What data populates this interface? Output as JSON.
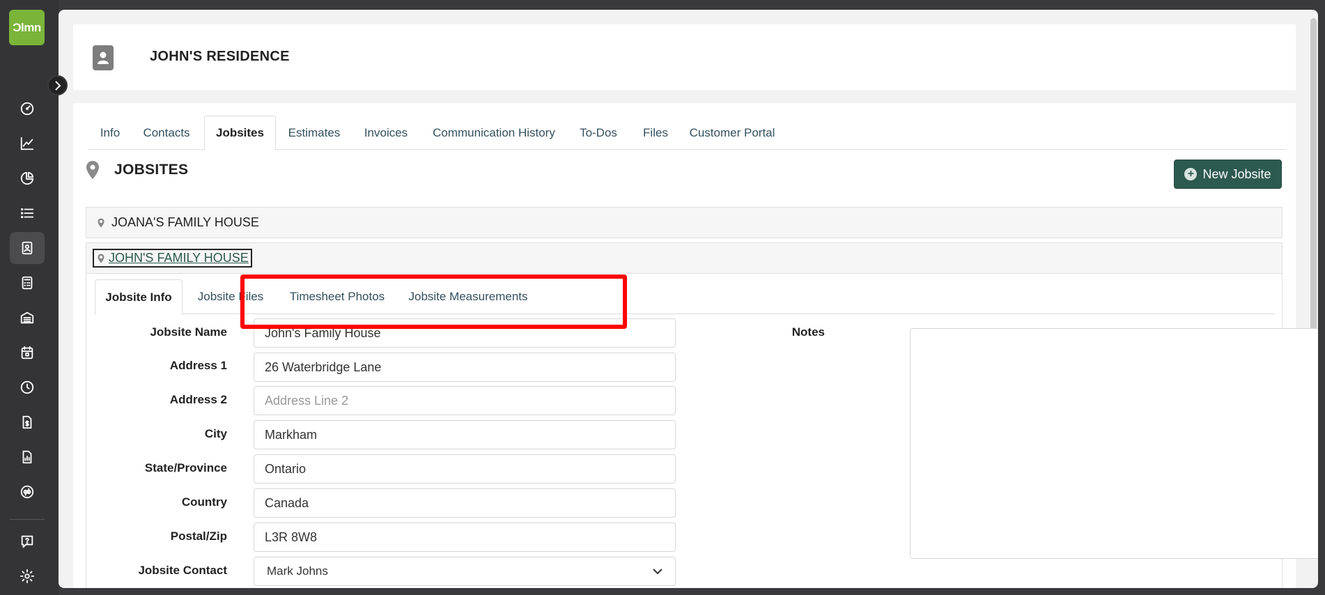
{
  "sidebar": {
    "logo_text": "Ɔlmn",
    "items": [
      {
        "name": "dashboard-icon"
      },
      {
        "name": "chart-line-icon"
      },
      {
        "name": "pie-chart-icon"
      },
      {
        "name": "list-icon"
      },
      {
        "name": "contacts-icon",
        "active": true
      },
      {
        "name": "calculator-icon"
      },
      {
        "name": "warehouse-icon"
      },
      {
        "name": "calendar-icon"
      },
      {
        "name": "clock-icon"
      },
      {
        "name": "invoice-icon"
      },
      {
        "name": "report-icon"
      },
      {
        "name": "quickbooks-icon"
      },
      {
        "name": "help-icon"
      },
      {
        "name": "settings-icon"
      }
    ]
  },
  "header": {
    "title": "JOHN'S RESIDENCE"
  },
  "tabs": [
    "Info",
    "Contacts",
    "Jobsites",
    "Estimates",
    "Invoices",
    "Communication History",
    "To-Dos",
    "Files",
    "Customer Portal"
  ],
  "active_tab": "Jobsites",
  "section": {
    "title": "JOBSITES",
    "new_button": "New Jobsite"
  },
  "jobsites": [
    {
      "label": "JOANA'S FAMILY HOUSE"
    },
    {
      "label": "JOHN'S FAMILY HOUSE"
    }
  ],
  "inner_tabs": [
    "Jobsite Info",
    "Jobsite Files",
    "Timesheet Photos",
    "Jobsite Measurements"
  ],
  "form": {
    "labels": {
      "name": "Jobsite Name",
      "address1": "Address 1",
      "address2": "Address 2",
      "city": "City",
      "state": "State/Province",
      "country": "Country",
      "postal": "Postal/Zip",
      "contact": "Jobsite Contact",
      "notes": "Notes"
    },
    "values": {
      "name": "John's Family House",
      "address1": "26 Waterbridge Lane",
      "address2": "",
      "city": "Markham",
      "state": "Ontario",
      "country": "Canada",
      "postal": "L3R 8W8",
      "contact": "Mark Johns",
      "notes": ""
    },
    "placeholders": {
      "address2": "Address Line 2"
    }
  },
  "colors": {
    "accent": "#2d5a4e",
    "logo": "#7ab539",
    "sidebar": "#343436",
    "highlight": "#ff0000"
  }
}
